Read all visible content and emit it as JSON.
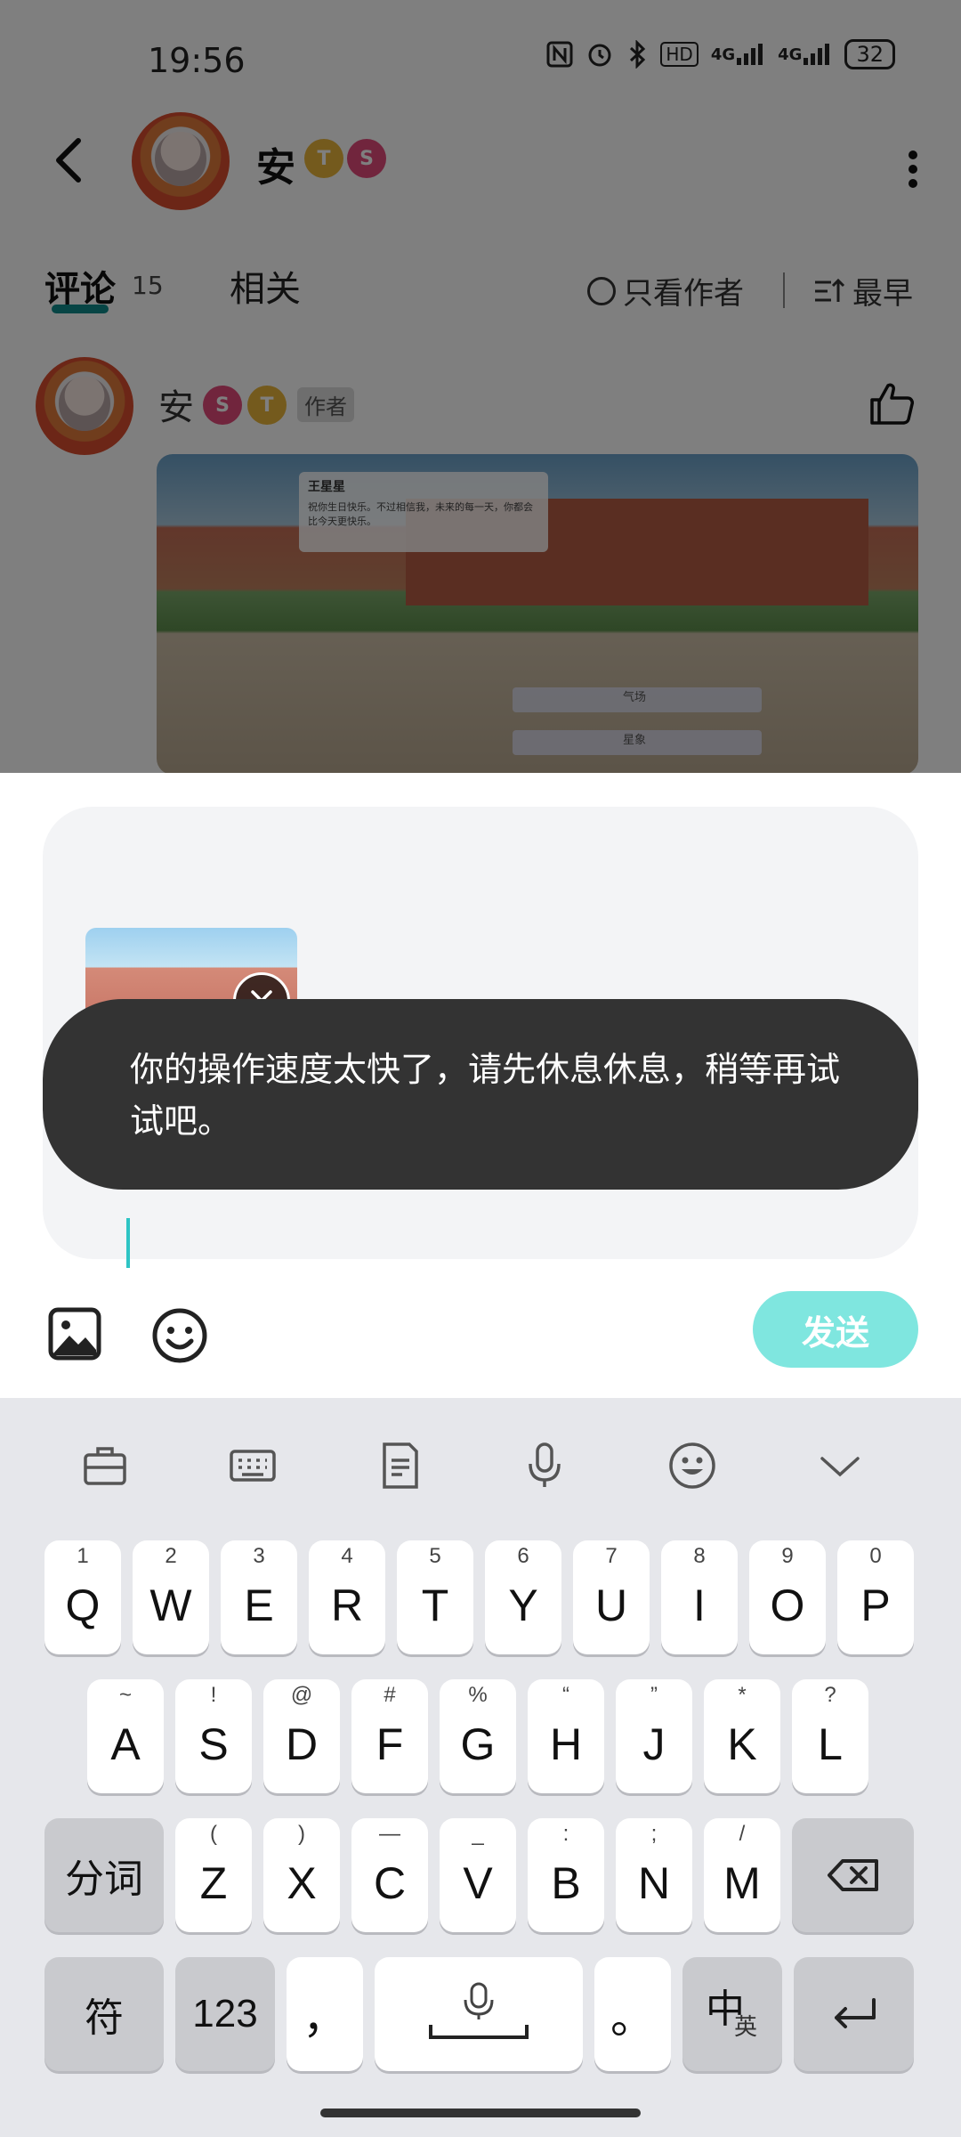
{
  "status_bar": {
    "time": "19:56",
    "icons": [
      "nfc-icon",
      "alarm-icon",
      "bluetooth-icon",
      "hd-icon",
      "signal-4g-icon",
      "signal-4g-icon"
    ],
    "hd_label": "HD",
    "net1": "4G",
    "net2": "4G",
    "battery": "32"
  },
  "header": {
    "username": "安",
    "badges": [
      "T",
      "S"
    ]
  },
  "tabs": {
    "comments_label": "评论",
    "comments_count": "15",
    "related_label": "相关",
    "only_author_label": "只看作者",
    "sort_label": "最早"
  },
  "comment": {
    "username": "安",
    "author_tag": "作者",
    "image_dialog_name": "王星星",
    "image_dialog_text": "祝你生日快乐。不过相信我，未来的每一天，你都会比今天更快乐。",
    "image_choices": [
      "气场",
      "星象"
    ]
  },
  "composer": {
    "toast_message": "你的操作速度太快了，请先休息休息，稍等再试试吧。",
    "send_label": "发送"
  },
  "keyboard": {
    "toolbar": [
      "briefcase-icon",
      "keyboard-icon",
      "clipboard-icon",
      "mic-icon",
      "emoji-icon",
      "collapse-icon"
    ],
    "row1": [
      {
        "sup": "1",
        "key": "Q"
      },
      {
        "sup": "2",
        "key": "W"
      },
      {
        "sup": "3",
        "key": "E"
      },
      {
        "sup": "4",
        "key": "R"
      },
      {
        "sup": "5",
        "key": "T"
      },
      {
        "sup": "6",
        "key": "Y"
      },
      {
        "sup": "7",
        "key": "U"
      },
      {
        "sup": "8",
        "key": "I"
      },
      {
        "sup": "9",
        "key": "O"
      },
      {
        "sup": "0",
        "key": "P"
      }
    ],
    "row2": [
      {
        "sup": "~",
        "key": "A"
      },
      {
        "sup": "!",
        "key": "S"
      },
      {
        "sup": "@",
        "key": "D"
      },
      {
        "sup": "#",
        "key": "F"
      },
      {
        "sup": "%",
        "key": "G"
      },
      {
        "sup": "“",
        "key": "H"
      },
      {
        "sup": "”",
        "key": "J"
      },
      {
        "sup": "*",
        "key": "K"
      },
      {
        "sup": "?",
        "key": "L"
      }
    ],
    "row3_left": "分词",
    "row3": [
      {
        "sup": "(",
        "key": "Z"
      },
      {
        "sup": ")",
        "key": "X"
      },
      {
        "sup": "—",
        "key": "C"
      },
      {
        "sup": "_",
        "key": "V"
      },
      {
        "sup": ":",
        "key": "B"
      },
      {
        "sup": ";",
        "key": "N"
      },
      {
        "sup": "/",
        "key": "M"
      }
    ],
    "symbols_label": "符",
    "numbers_label": "123",
    "comma": "，",
    "period": "。",
    "lang_main": "中",
    "lang_sub": "英"
  }
}
